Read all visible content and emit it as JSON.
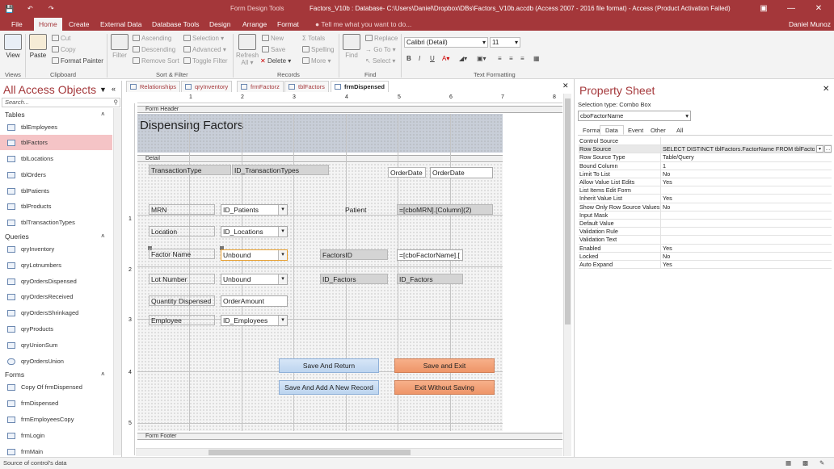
{
  "titlebar": {
    "app_title": "Factors_V10b : Database- C:\\Users\\Daniel\\Dropbox\\DBs\\Factors_V10b.accdb (Access 2007 - 2016 file format) - Access (Product Activation Failed)",
    "context_tab": "Form Design Tools",
    "minimize": "—",
    "restore": "❐",
    "close": "✕"
  },
  "ribbon_tabs": [
    "File",
    "Home",
    "Create",
    "External Data",
    "Database Tools",
    "Design",
    "Arrange",
    "Format"
  ],
  "tell_me": "Tell me what you want to do...",
  "user": "Daniel Munoz",
  "ribbon": {
    "view": "View",
    "paste": "Paste",
    "cut": "Cut",
    "copy": "Copy",
    "format_painter": "Format Painter",
    "filter": "Filter",
    "ascending": "Ascending",
    "descending": "Descending",
    "remove_sort": "Remove Sort",
    "selection": "Selection",
    "advanced": "Advanced",
    "toggle_filter": "Toggle Filter",
    "refresh": "Refresh",
    "refresh_all": "All",
    "new": "New",
    "save": "Save",
    "delete": "Delete",
    "totals": "Totals",
    "spelling": "Spelling",
    "more": "More",
    "find": "Find",
    "replace": "Replace",
    "goto": "Go To",
    "select": "Select",
    "font_name": "Calibri (Detail)",
    "font_size": "11",
    "bold": "B",
    "italic": "I",
    "underline": "U",
    "groups": [
      "Views",
      "Clipboard",
      "Sort & Filter",
      "Records",
      "Find",
      "Text Formatting"
    ]
  },
  "nav": {
    "title": "All Access Objects",
    "search_placeholder": "Search...",
    "tables_header": "Tables",
    "tables": [
      "tblEmployees",
      "tblFactors",
      "tblLocations",
      "tblOrders",
      "tblPatients",
      "tblProducts",
      "tblTransactionTypes"
    ],
    "queries_header": "Queries",
    "queries": [
      "qryInventory",
      "qryLotnumbers",
      "qryOrdersDispensed",
      "qryOrdersReceived",
      "qryOrdersShrinkaged",
      "qryProducts",
      "qryUnionSum",
      "qryOrdersUnion"
    ],
    "forms_header": "Forms",
    "forms": [
      "Copy Of frmDispensed",
      "frmDispensed",
      "frmEmployeesCopy",
      "frmLogin",
      "frmMain"
    ]
  },
  "doc_tabs": [
    "Relationships",
    "qryInventory",
    "frmFactorz",
    "tblFactors",
    "frmDispensed"
  ],
  "form": {
    "header_bar": "Form Header",
    "detail_bar": "Detail",
    "footer_bar": "Form Footer",
    "title": "Dispensing Factors",
    "labels": {
      "transaction_type": "TransactionType",
      "id_transaction_types": "ID_TransactionTypes",
      "order_date_label": "OrderDate",
      "order_date_field": "OrderDate",
      "mrn": "MRN",
      "id_patients": "ID_Patients",
      "patient": "Patient",
      "patient_expr": "=[cboMRN].[Column](2)",
      "location": "Location",
      "id_locations": "ID_Locations",
      "factor_name": "Factor Name",
      "unbound1": "Unbound",
      "factors_id": "FactorsID",
      "factors_expr": "=[cboFactorName].[",
      "lot_number": "Lot Number",
      "unbound2": "Unbound",
      "id_factors_label": "ID_Factors",
      "id_factors_field": "ID_Factors",
      "quantity_dispensed": "Quantity Dispensed",
      "order_amount": "OrderAmount",
      "employee": "Employee",
      "id_employees": "ID_Employees"
    },
    "buttons": {
      "save_return": "Save And Return",
      "save_exit": "Save and Exit",
      "save_add_new": "Save And Add A New Record",
      "exit_no_save": "Exit Without Saving"
    }
  },
  "property_sheet": {
    "title": "Property Sheet",
    "selection_type": "Selection type: Combo Box",
    "selected_object": "cboFactorName",
    "tabs": [
      "Format",
      "Data",
      "Event",
      "Other",
      "All"
    ],
    "active_tab": "Data",
    "rows": [
      {
        "name": "Control Source",
        "value": ""
      },
      {
        "name": "Row Source",
        "value": "SELECT DISTINCT tblFactors.FactorName FROM tblFactors;"
      },
      {
        "name": "Row Source Type",
        "value": "Table/Query"
      },
      {
        "name": "Bound Column",
        "value": "1"
      },
      {
        "name": "Limit To List",
        "value": "No"
      },
      {
        "name": "Allow Value List Edits",
        "value": "Yes"
      },
      {
        "name": "List Items Edit Form",
        "value": ""
      },
      {
        "name": "Inherit Value List",
        "value": "Yes"
      },
      {
        "name": "Show Only Row Source Values",
        "value": "No"
      },
      {
        "name": "Input Mask",
        "value": ""
      },
      {
        "name": "Default Value",
        "value": ""
      },
      {
        "name": "Validation Rule",
        "value": ""
      },
      {
        "name": "Validation Text",
        "value": ""
      },
      {
        "name": "Enabled",
        "value": "Yes"
      },
      {
        "name": "Locked",
        "value": "No"
      },
      {
        "name": "Auto Expand",
        "value": "Yes"
      }
    ]
  },
  "ruler_numbers": [
    "1",
    "2",
    "3",
    "4",
    "5",
    "6",
    "7",
    "8"
  ],
  "status": "Source of control's data",
  "colors": {
    "accent": "#a4373a",
    "selected_nav": "#f5c4c6",
    "blue_button": "#bcd4ef",
    "orange_button": "#ee9568"
  }
}
